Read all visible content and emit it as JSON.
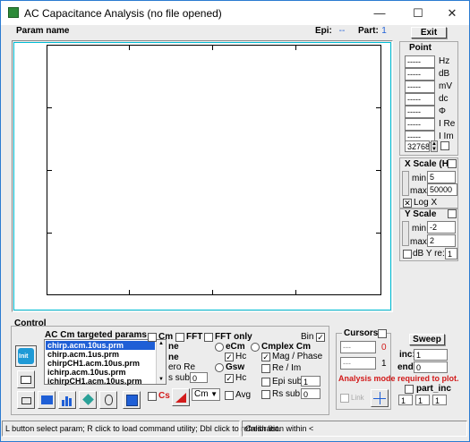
{
  "window": {
    "title": "AC Capacitance Analysis (no file opened)",
    "minimize_glyph": "—",
    "maximize_glyph": "☐",
    "close_glyph": "✕"
  },
  "header": {
    "param_name_label": "Param name",
    "epi_label": "Epi:",
    "epi_value": "--",
    "part_label": "Part:",
    "part_value": "1",
    "exit_label": "Exit"
  },
  "point": {
    "title": "Point",
    "rows": [
      {
        "value": "-----",
        "unit": "Hz"
      },
      {
        "value": "-----",
        "unit": "dB"
      },
      {
        "value": "-----",
        "unit": "mV"
      },
      {
        "value": "-----",
        "unit": "dc"
      },
      {
        "value": "-----",
        "unit": "Φ"
      },
      {
        "value": "-----",
        "unit": "I Re"
      },
      {
        "value": "-----",
        "unit": "I Im"
      }
    ],
    "counter": "32768"
  },
  "xscale": {
    "title": "X Scale (Hz)",
    "min_label": "min:",
    "min_value": "5",
    "max_label": "max:",
    "max_value": "50000",
    "log_label": "Log X"
  },
  "yscale": {
    "title": "Y Scale",
    "min_label": "min:",
    "min_value": "-2",
    "max_label": "max:",
    "max_value": "2",
    "db_label": "dB Y re:",
    "db_value": "1"
  },
  "control": {
    "title": "Control",
    "targeted_label": "AC Cm targeted params",
    "init_label": "Init",
    "params": [
      "chirp.acm.10us.prm",
      "chirp.acm.1us.prm",
      "chirpCH1.acm.10us.prm",
      "ichirp.acm.10us.prm",
      "ichirpCH1.acm.10us.prm"
    ],
    "cm_label": "Cm",
    "fft_label": "FFT",
    "fft_only_label": "FFT only",
    "bin_label": "Bin",
    "row2_partial": "ne",
    "row3_partial": "ne",
    "zero_re_label": "ero Re",
    "s_sub_label": "s sub:",
    "s_sub_value": "0",
    "ecm_label": "eCm",
    "hc_label": "Hc",
    "gsw_label": "Gsw",
    "hc2_label": "Hc",
    "cmplex_label": "Cmplex Cm",
    "mag_phase_label": "Mag / Phase",
    "re_im_label": "Re / Im",
    "epi_sub_label": "Epi sub:",
    "epi_sub_value": "1",
    "rs_sub_label": "Rs sub:",
    "rs_sub_value": "0",
    "cs_label": "Cs",
    "cm_select": "Cm",
    "avg_label": "Avg"
  },
  "cursors": {
    "title": "Cursors",
    "field1": "---",
    "value1": "0",
    "field2": "---",
    "value2": "1",
    "link_label": "Link",
    "warning": "Analysis mode required to plot."
  },
  "sweep": {
    "label": "Sweep",
    "inc_label": "inc:",
    "inc_value": "1",
    "end_label": "end:",
    "end_value": "0",
    "part_inc_label": "part_inc",
    "v1": "1",
    "v2": "1",
    "v3": "1"
  },
  "status": {
    "left": "L button select param; R click to load command utility; Dbl click to refresh list.",
    "right": "Calibration within <"
  },
  "colors": {
    "accent": "#1f5fd6",
    "warning": "#d21a1a",
    "plot_border": "#00bcd4"
  }
}
